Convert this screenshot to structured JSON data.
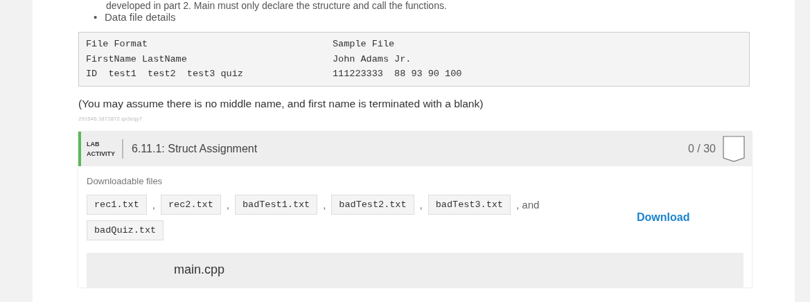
{
  "intro_line": "developed in part 2. Main must only declare the structure and call the functions.",
  "bullets": [
    {
      "marker": "•",
      "text": "Data file details"
    }
  ],
  "code_block": {
    "rows": [
      [
        "File Format",
        "Sample File"
      ],
      [
        "FirstName LastName",
        "John Adams Jr."
      ],
      [
        "ID  test1  test2  test3 quiz",
        "111223333  88 93 90 100"
      ]
    ]
  },
  "note": "(You may assume there is no middle name, and first name is terminated with a blank)",
  "reference_id": "291546.1872872.qx3zqy7",
  "lab": {
    "label_line_1": "LAB",
    "label_line_2": "ACTIVITY",
    "title": "6.11.1: Struct Assignment",
    "score": "0 / 30",
    "completed": false,
    "downloads_heading": "Downloadable files",
    "files": [
      {
        "name": "rec1.txt",
        "separator": ","
      },
      {
        "name": "rec2.txt",
        "separator": ","
      },
      {
        "name": "badTest1.txt",
        "separator": ","
      },
      {
        "name": "badTest2.txt",
        "separator": ","
      },
      {
        "name": "badTest3.txt",
        "separator": ", and"
      },
      {
        "name": "badQuiz.txt"
      }
    ],
    "download_button": "Download",
    "editor_filename": "main.cpp"
  }
}
